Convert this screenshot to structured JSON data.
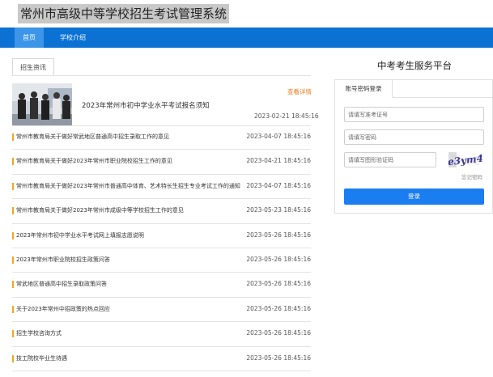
{
  "header": {
    "site_title": "常州市高级中等学校招生考试管理系统"
  },
  "nav": {
    "items": [
      {
        "label": "首页",
        "active": true
      },
      {
        "label": "学校介绍",
        "active": false
      }
    ]
  },
  "news": {
    "tab_label": "招生资讯",
    "more_label": "查看详情",
    "featured": {
      "title": "2023年常州市初中学业水平考试报名须知",
      "date": "2023-02-21 18:45:16"
    },
    "items": [
      {
        "title": "常州市教育局关于做好常武地区普通高中招生录取工作的意见",
        "date": "2023-04-07 18:45:16"
      },
      {
        "title": "常州市教育局关于做好2023年常州市职业院校招生工作的意见",
        "date": "2023-04-21 18:45:16"
      },
      {
        "title": "常州市教育局关于做好2023年常州市普通高中体育、艺术特长生招生专业考试工作的通知",
        "date": "2023-04-07 18:45:16"
      },
      {
        "title": "常州市教育局关于做好2023年常州市成级中等学校招生工作的意见",
        "date": "2023-05-23 18:45:16"
      },
      {
        "title": "2023年常州市初中学业水平考试网上填报志愿说明",
        "date": "2023-05-26 18:45:16"
      },
      {
        "title": "2023年常州市职业院校招生政策问答",
        "date": "2023-05-26 18:45:16"
      },
      {
        "title": "常武地区普通高中招生录取政策问答",
        "date": "2023-05-26 18:45:16"
      },
      {
        "title": "关于2023年常州中招政策的热点回应",
        "date": "2023-05-26 18:45:16"
      },
      {
        "title": "招生学校咨询方式",
        "date": "2023-05-26 18:45:16"
      },
      {
        "title": "技工院校毕业生待遇",
        "date": "2023-05-26 18:45:16"
      }
    ]
  },
  "login": {
    "platform_title": "中考考生服务平台",
    "tab_label": "账号密码登录",
    "account_placeholder": "请填写准考证号",
    "password_placeholder": "请填写密码",
    "captcha_placeholder": "请填写图形验证码",
    "captcha_text": "e3ym4",
    "forgot_label": "忘记密码",
    "submit_label": "登录"
  },
  "colors": {
    "nav_bg": "#0b72d4",
    "nav_active": "#3c95e8",
    "accent_orange": "#ea7a1f",
    "bullet": "#f3a521",
    "login_button": "#1a7df0"
  }
}
